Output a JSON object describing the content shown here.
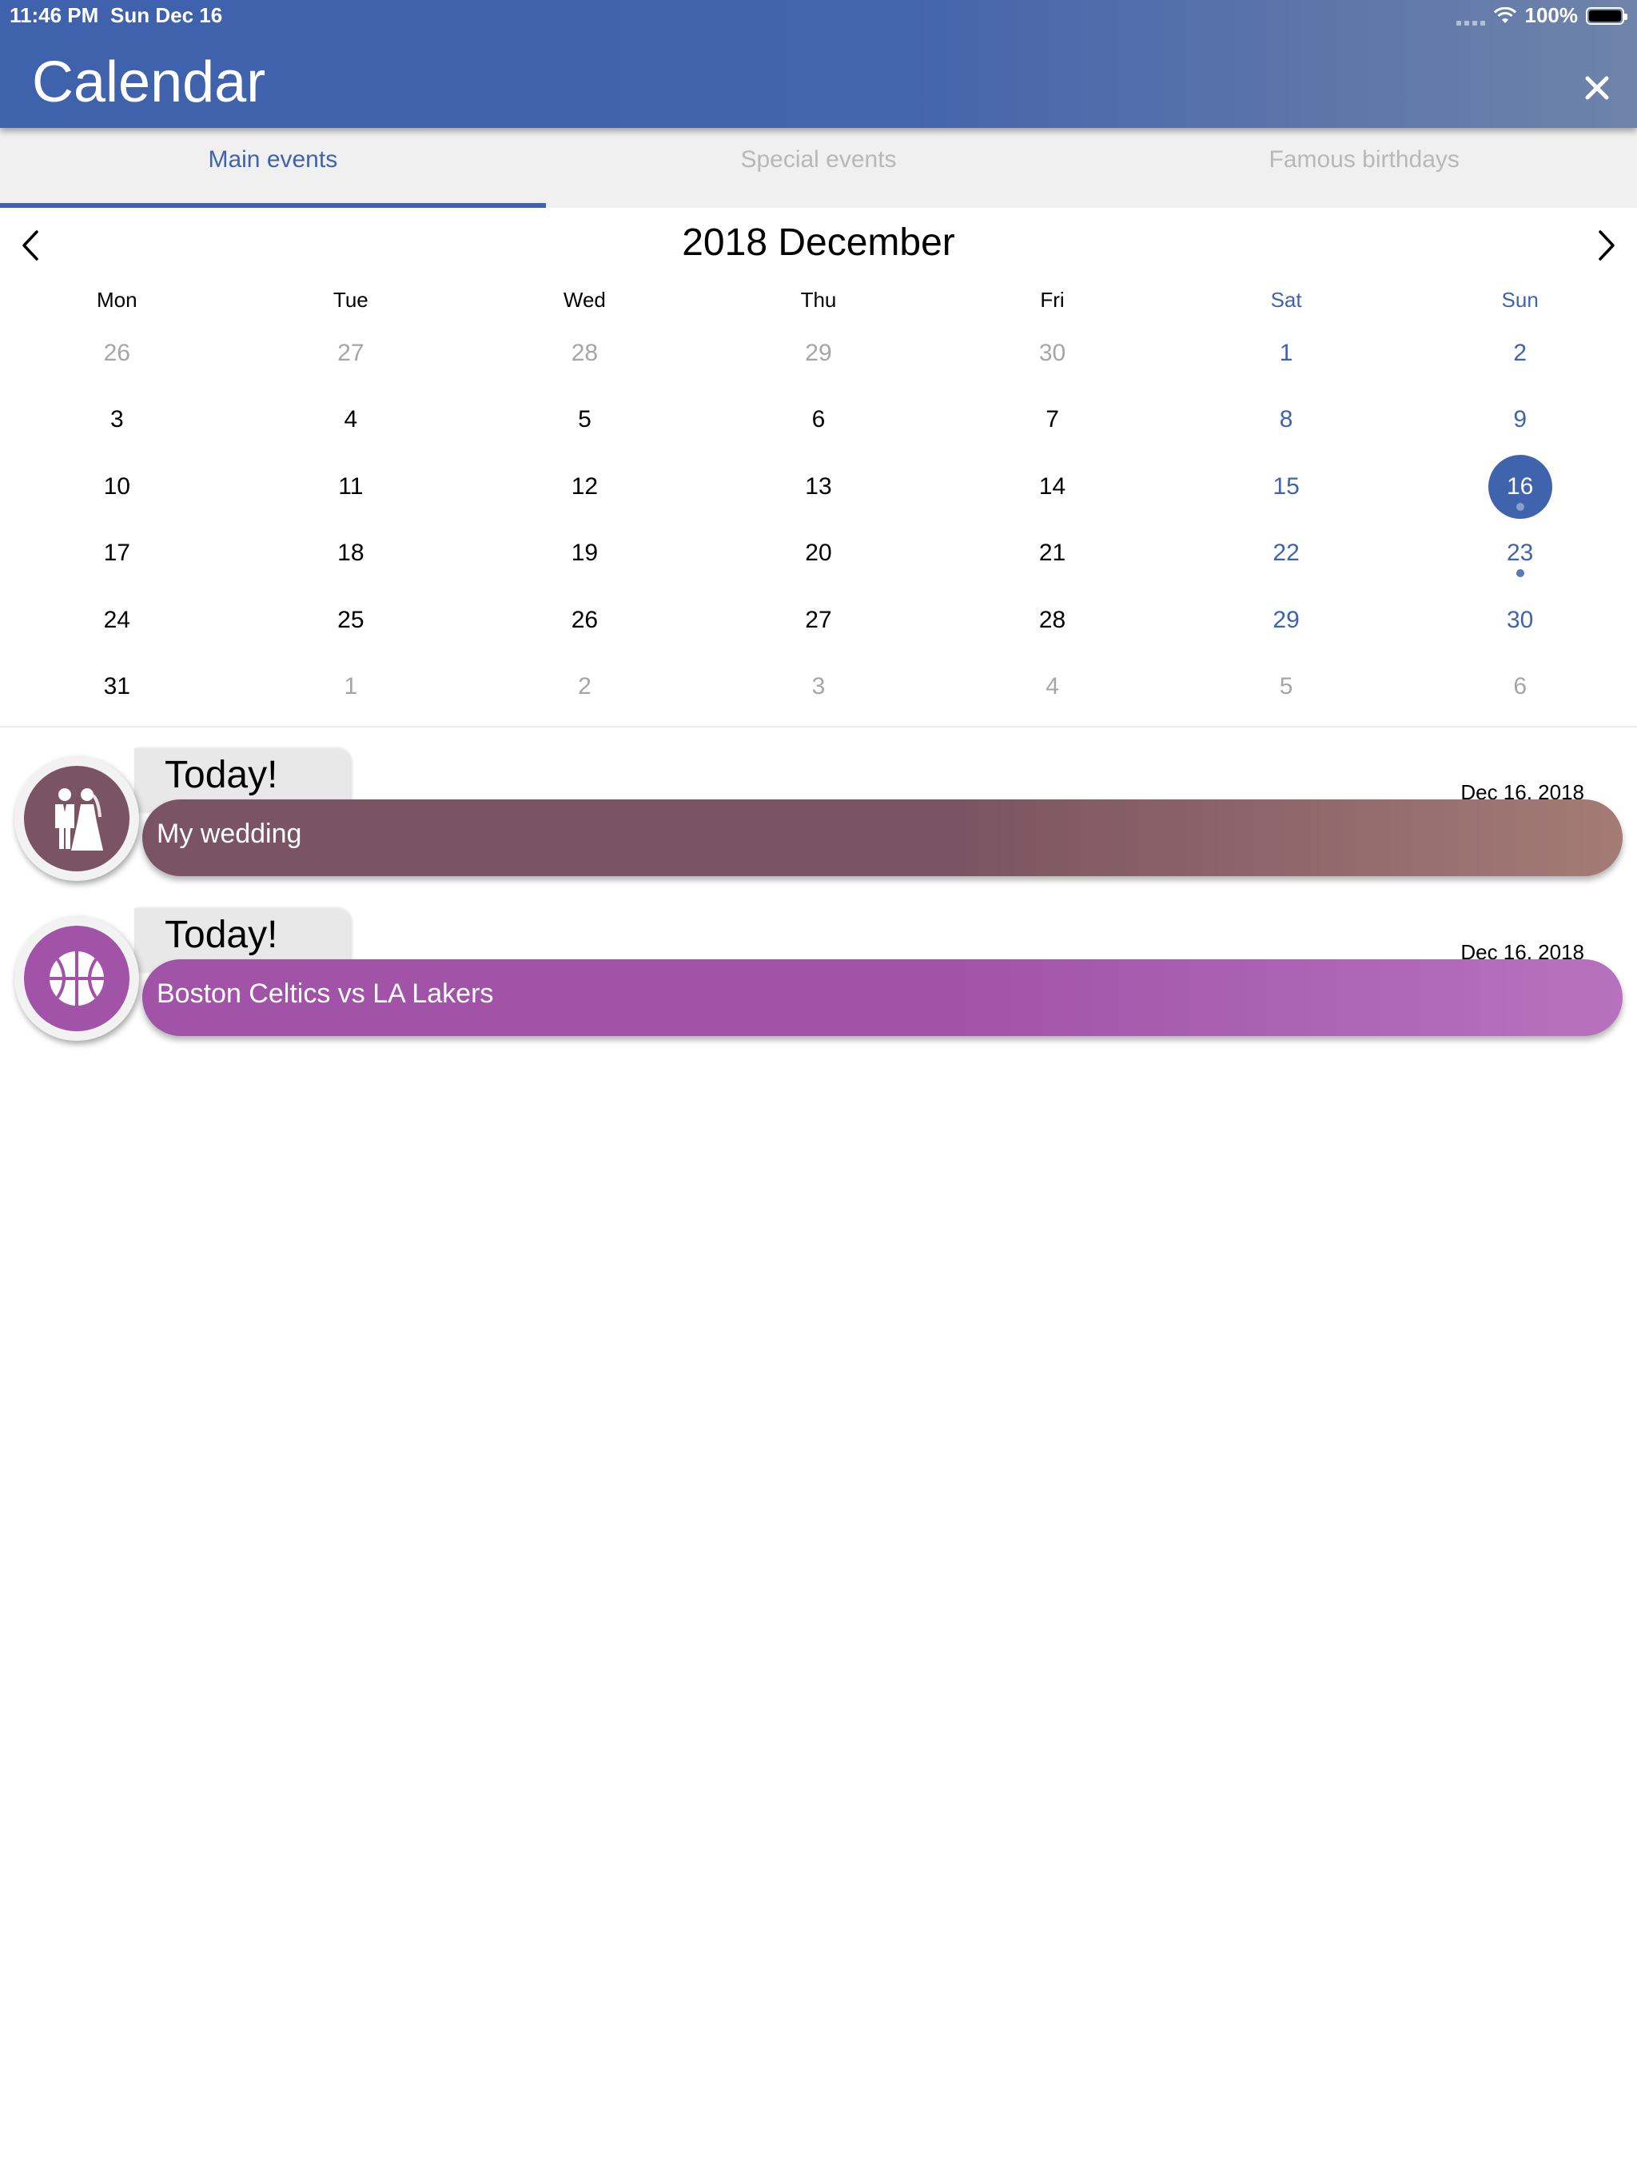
{
  "status_bar": {
    "time": "11:46 PM",
    "date": "Sun Dec 16",
    "battery": "100%",
    "battery_level": 1.0
  },
  "header": {
    "title": "Calendar",
    "close_icon": "close-icon"
  },
  "tabs": [
    {
      "label": "Main events",
      "active": true
    },
    {
      "label": "Special events",
      "active": false
    },
    {
      "label": "Famous birthdays",
      "active": false
    }
  ],
  "calendar": {
    "month_title": "2018 December",
    "prev_icon": "chevron-left-icon",
    "next_icon": "chevron-right-icon",
    "weekdays": [
      "Mon",
      "Tue",
      "Wed",
      "Thu",
      "Fri",
      "Sat",
      "Sun"
    ],
    "weeks": [
      [
        {
          "d": "26",
          "other": true
        },
        {
          "d": "27",
          "other": true
        },
        {
          "d": "28",
          "other": true
        },
        {
          "d": "29",
          "other": true
        },
        {
          "d": "30",
          "other": true
        },
        {
          "d": "1"
        },
        {
          "d": "2"
        }
      ],
      [
        {
          "d": "3"
        },
        {
          "d": "4"
        },
        {
          "d": "5"
        },
        {
          "d": "6"
        },
        {
          "d": "7"
        },
        {
          "d": "8"
        },
        {
          "d": "9"
        }
      ],
      [
        {
          "d": "10"
        },
        {
          "d": "11"
        },
        {
          "d": "12"
        },
        {
          "d": "13"
        },
        {
          "d": "14"
        },
        {
          "d": "15"
        },
        {
          "d": "16",
          "selected": true,
          "event": true
        }
      ],
      [
        {
          "d": "17"
        },
        {
          "d": "18"
        },
        {
          "d": "19"
        },
        {
          "d": "20"
        },
        {
          "d": "21"
        },
        {
          "d": "22"
        },
        {
          "d": "23",
          "event": true
        }
      ],
      [
        {
          "d": "24"
        },
        {
          "d": "25"
        },
        {
          "d": "26"
        },
        {
          "d": "27"
        },
        {
          "d": "28"
        },
        {
          "d": "29"
        },
        {
          "d": "30"
        }
      ],
      [
        {
          "d": "31"
        },
        {
          "d": "1",
          "other": true
        },
        {
          "d": "2",
          "other": true
        },
        {
          "d": "3",
          "other": true
        },
        {
          "d": "4",
          "other": true
        },
        {
          "d": "5",
          "other": true
        },
        {
          "d": "6",
          "other": true
        }
      ]
    ]
  },
  "events": [
    {
      "today_label": "Today!",
      "title": "My wedding",
      "date": "Dec 16, 2018",
      "icon": "wedding-couple-icon",
      "color": "#7a5462",
      "gradient_end": "#a47b75"
    },
    {
      "today_label": "Today!",
      "title": "Boston Celtics vs LA Lakers",
      "date": "Dec 16, 2018",
      "icon": "basketball-icon",
      "color": "#a153a8",
      "gradient_end": "#b772bd"
    }
  ],
  "colors": {
    "header_start": "#3f62ac",
    "header_end": "#6f83aa",
    "accent": "#3f63ad"
  }
}
